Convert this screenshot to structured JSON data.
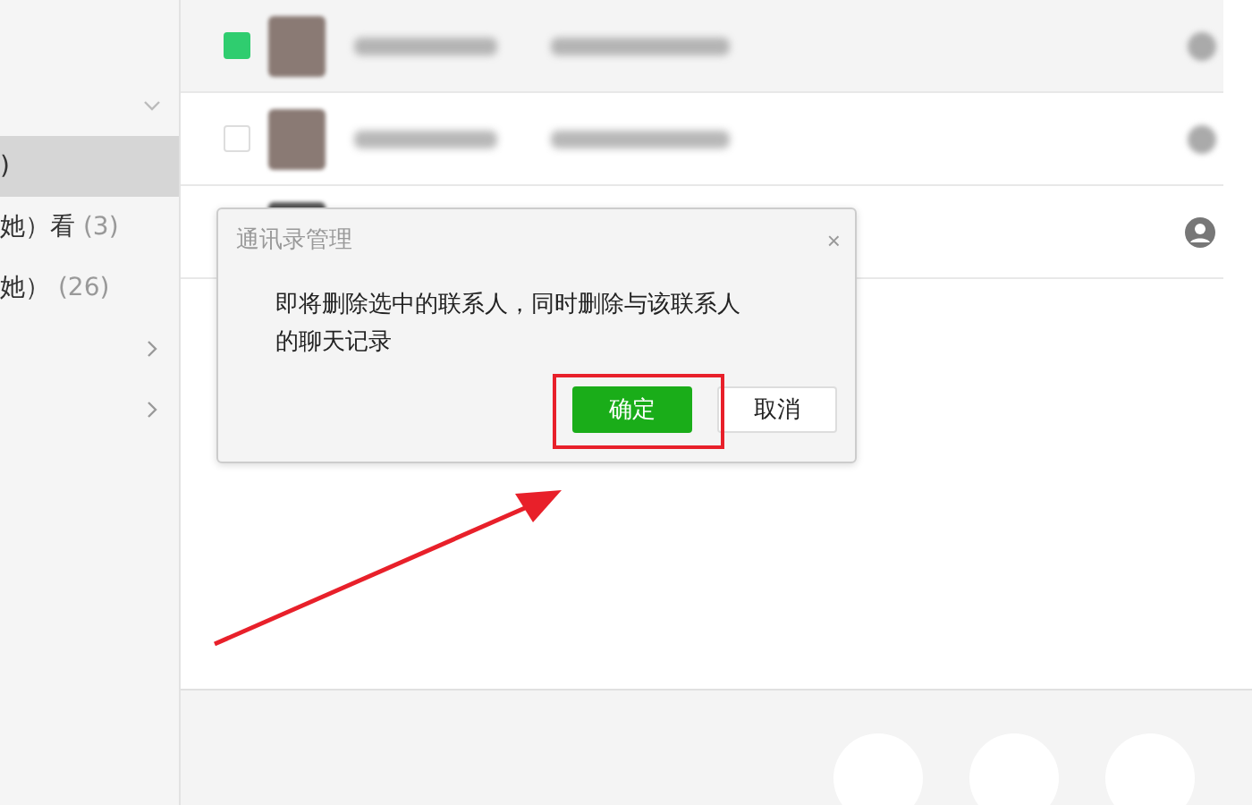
{
  "sidebar": {
    "items": [
      {
        "label": ")",
        "selected": true,
        "kind": "text"
      },
      {
        "label": "她）看",
        "count": "(3)",
        "selected": false,
        "kind": "text"
      },
      {
        "label": "她）",
        "count": "(26)",
        "selected": false,
        "kind": "text"
      },
      {
        "selected": false,
        "kind": "chevron"
      },
      {
        "selected": false,
        "kind": "chevron"
      }
    ]
  },
  "contacts": [
    {
      "checked": true,
      "kind": "blurred"
    },
    {
      "checked": false,
      "kind": "blurred"
    },
    {
      "kind": "hidden"
    }
  ],
  "dialog": {
    "title": "通讯录管理",
    "close": "×",
    "message": "即将删除选中的联系人，同时删除与该联系人的聊天记录",
    "buttons": [
      {
        "label": "确定",
        "kind": "primary"
      },
      {
        "label": "取消",
        "kind": "secondary"
      }
    ]
  }
}
